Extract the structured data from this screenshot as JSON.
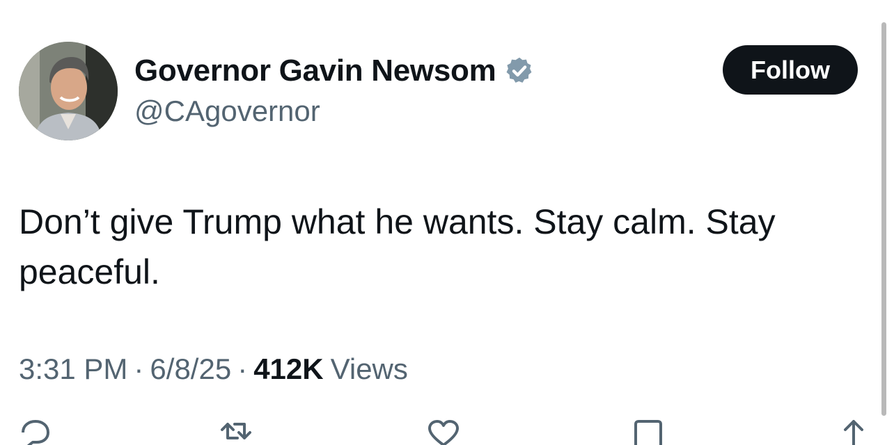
{
  "author": {
    "display_name": "Governor Gavin Newsom",
    "handle": "@CAgovernor",
    "verified_color": "#829aab"
  },
  "follow_button": {
    "label": "Follow"
  },
  "tweet": {
    "text": "Don’t give Trump what he wants. Stay calm. Stay peaceful."
  },
  "meta": {
    "time": "3:31 PM",
    "separator": "·",
    "date": "6/8/25",
    "views_count": "412K",
    "views_label": "Views"
  },
  "actions": {
    "reply_icon": "reply-icon",
    "retweet_icon": "retweet-icon",
    "like_icon": "heart-icon",
    "bookmark_icon": "bookmark-icon",
    "share_icon": "share-icon"
  },
  "colors": {
    "text_primary": "#0f1419",
    "text_secondary": "#536471",
    "button_bg": "#0f1419",
    "button_text": "#ffffff"
  }
}
